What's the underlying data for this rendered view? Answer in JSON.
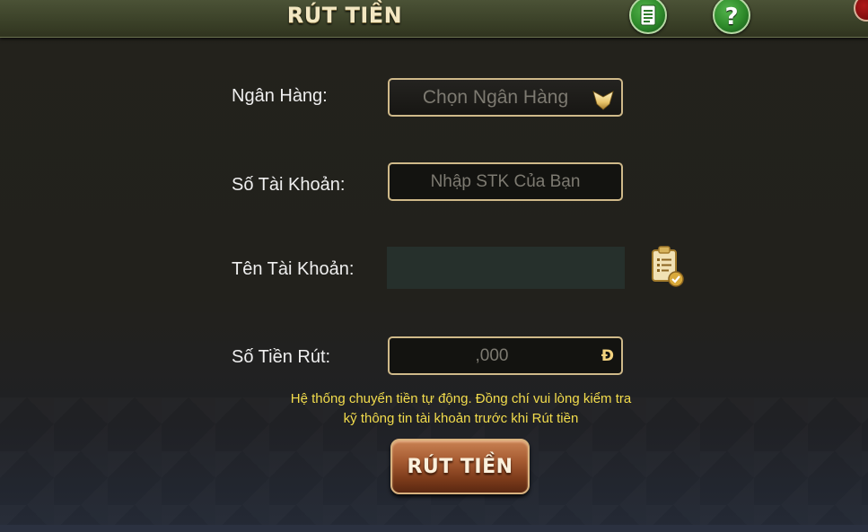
{
  "header": {
    "title": "RÚT TIỀN",
    "list_icon": "document-list-icon",
    "help_icon": "help-icon",
    "help_glyph": "?",
    "close_icon": "close-icon"
  },
  "form": {
    "bank": {
      "label": "Ngân Hàng:",
      "placeholder": "Chọn Ngân Hàng",
      "icon": "chevron-down-icon"
    },
    "account_number": {
      "label": "Số Tài Khoản:",
      "placeholder": "Nhập STK Của Bạn",
      "value": ""
    },
    "account_name": {
      "label": "Tên Tài Khoản:",
      "value": "",
      "icon": "clipboard-check-icon"
    },
    "amount": {
      "label": "Số Tiền Rút:",
      "placeholder": ",000",
      "currency": "Đ"
    }
  },
  "notice": {
    "line1": "Hệ thống chuyển tiền tự động. Đồng chí vui lòng kiểm tra",
    "line2": "kỹ thông tin tài khoản trước khi Rút tiền"
  },
  "actions": {
    "withdraw_label": "RÚT TIỀN"
  },
  "colors": {
    "header_title": "#f3e7c2",
    "notice": "#f2dc4c",
    "button": "#a55a31",
    "field_border": "#cfb989",
    "circle_button": "#2e8a2a"
  }
}
